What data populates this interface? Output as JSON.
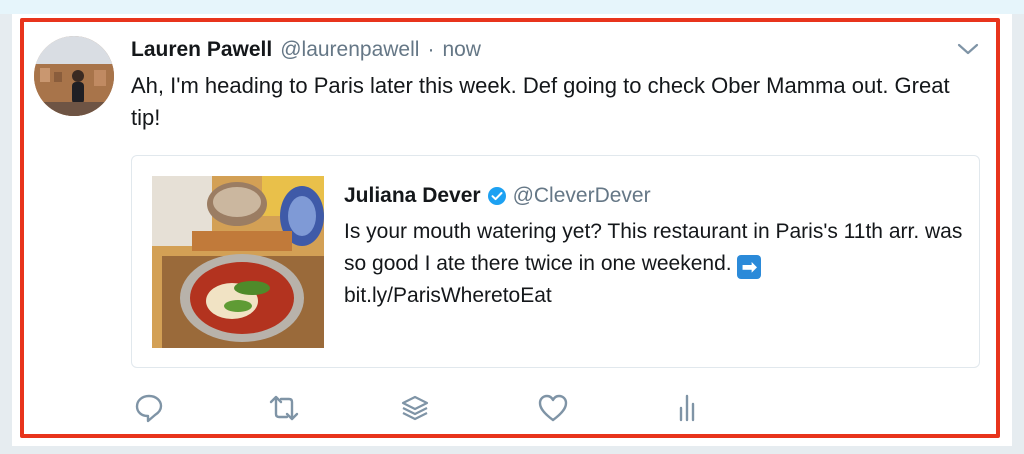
{
  "tweet": {
    "author_name": "Lauren Pawell",
    "author_handle": "@laurenpawell",
    "separator": "·",
    "timestamp": "now",
    "text": "Ah, I'm heading to Paris later this week. Def going to check Ober Mamma out. Great tip!",
    "avatar": "avatar-photo",
    "menu_icon": "chevron-down-icon"
  },
  "quoted_tweet": {
    "author_name": "Juliana Dever",
    "verified_icon": "verified-badge-icon",
    "author_handle": "@CleverDever",
    "text": "Is your mouth watering yet? This restaurant in Paris's 11th arr. was so good I ate there twice in one weekend.",
    "arrow_emoji": "➡",
    "link": "bit.ly/ParisWheretoEat",
    "image": "food-photo-pasta-dish"
  },
  "actions": [
    {
      "icon": "reply-icon"
    },
    {
      "icon": "retweet-icon"
    },
    {
      "icon": "stack-layers-icon"
    },
    {
      "icon": "like-heart-icon"
    },
    {
      "icon": "analytics-bar-icon"
    }
  ],
  "colors": {
    "highlight_border": "#e8341c",
    "verified_blue": "#1da1f2",
    "secondary_text": "#657786",
    "primary_text": "#14171a",
    "icon_gray": "#7f94a6"
  }
}
